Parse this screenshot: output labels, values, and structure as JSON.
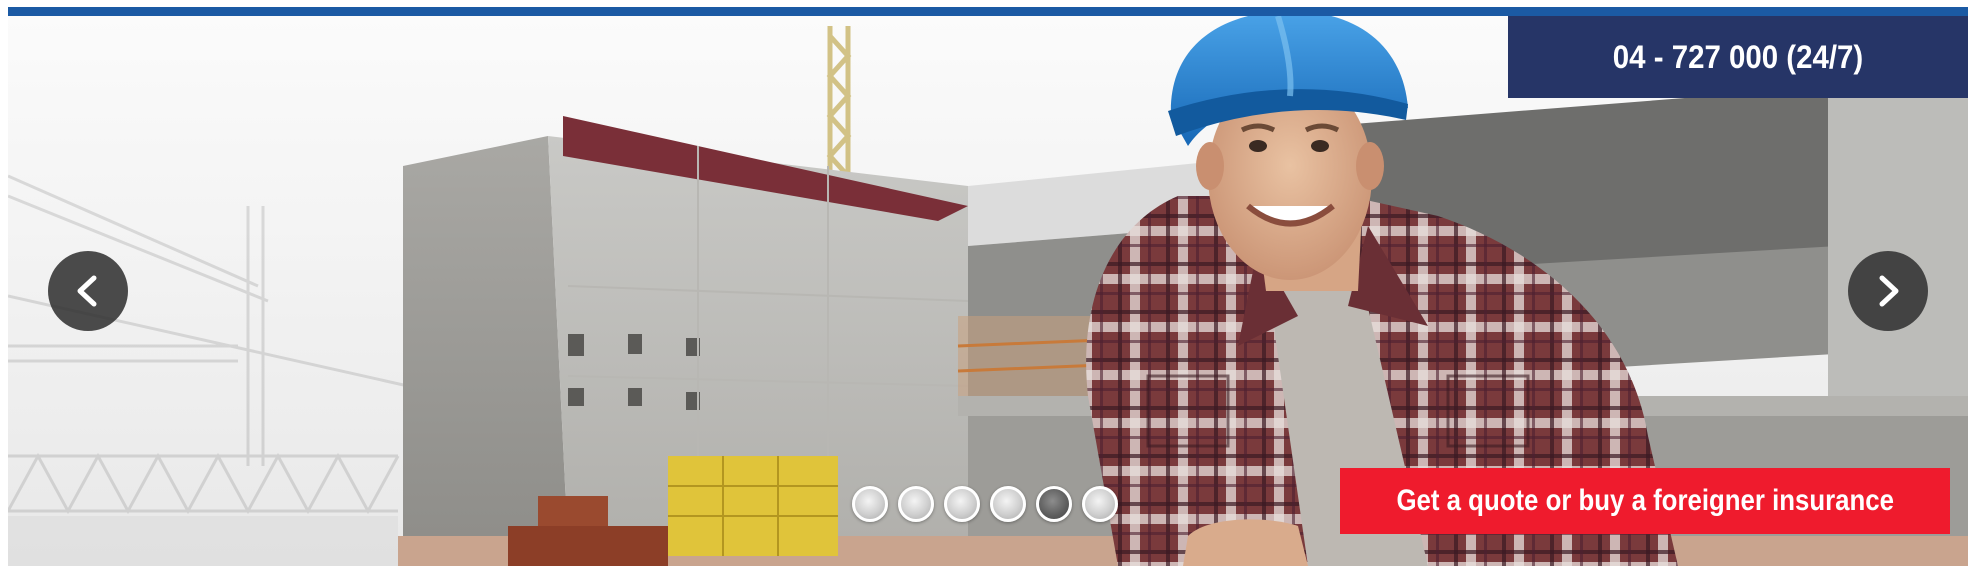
{
  "header": {
    "phone": "04 - 727 000 (24/7)"
  },
  "slider": {
    "prev_icon": "chevron-left-icon",
    "next_icon": "chevron-right-icon",
    "dot_count": 6,
    "active_dot": 5,
    "cta_label": "Get a quote or buy a foreigner insurance"
  },
  "colors": {
    "top_bar": "#1b5aa4",
    "phone_bg": "#263567",
    "cta_bg": "#ef1b2d",
    "arrow_bg": "#333333"
  }
}
